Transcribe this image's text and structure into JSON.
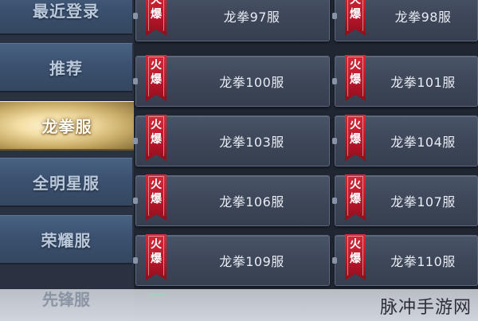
{
  "sidebar": {
    "tabs": [
      {
        "label": "最近登录",
        "active": false
      },
      {
        "label": "推荐",
        "active": false
      },
      {
        "label": "龙拳服",
        "active": true
      },
      {
        "label": "全明星服",
        "active": false
      },
      {
        "label": "荣耀服",
        "active": false
      },
      {
        "label": "先锋服",
        "active": false
      }
    ]
  },
  "servers": [
    {
      "badge_top": "火",
      "badge_bottom": "爆",
      "name": "龙拳97服"
    },
    {
      "badge_top": "火",
      "badge_bottom": "爆",
      "name": "龙拳98服"
    },
    {
      "badge_top": "火",
      "badge_bottom": "爆",
      "name": "龙拳100服"
    },
    {
      "badge_top": "火",
      "badge_bottom": "爆",
      "name": "龙拳101服"
    },
    {
      "badge_top": "火",
      "badge_bottom": "爆",
      "name": "龙拳103服"
    },
    {
      "badge_top": "火",
      "badge_bottom": "爆",
      "name": "龙拳104服"
    },
    {
      "badge_top": "火",
      "badge_bottom": "爆",
      "name": "龙拳106服"
    },
    {
      "badge_top": "火",
      "badge_bottom": "爆",
      "name": "龙拳107服"
    },
    {
      "badge_top": "火",
      "badge_bottom": "爆",
      "name": "龙拳109服"
    },
    {
      "badge_top": "火",
      "badge_bottom": "爆",
      "name": "龙拳110服"
    }
  ],
  "watermark": "脉冲手游网",
  "colors": {
    "badge_red": "#c11d2e",
    "active_tab_gold": "#f4dfa6",
    "tab_blue": "#3b5170",
    "card_gray": "#3e4759"
  }
}
